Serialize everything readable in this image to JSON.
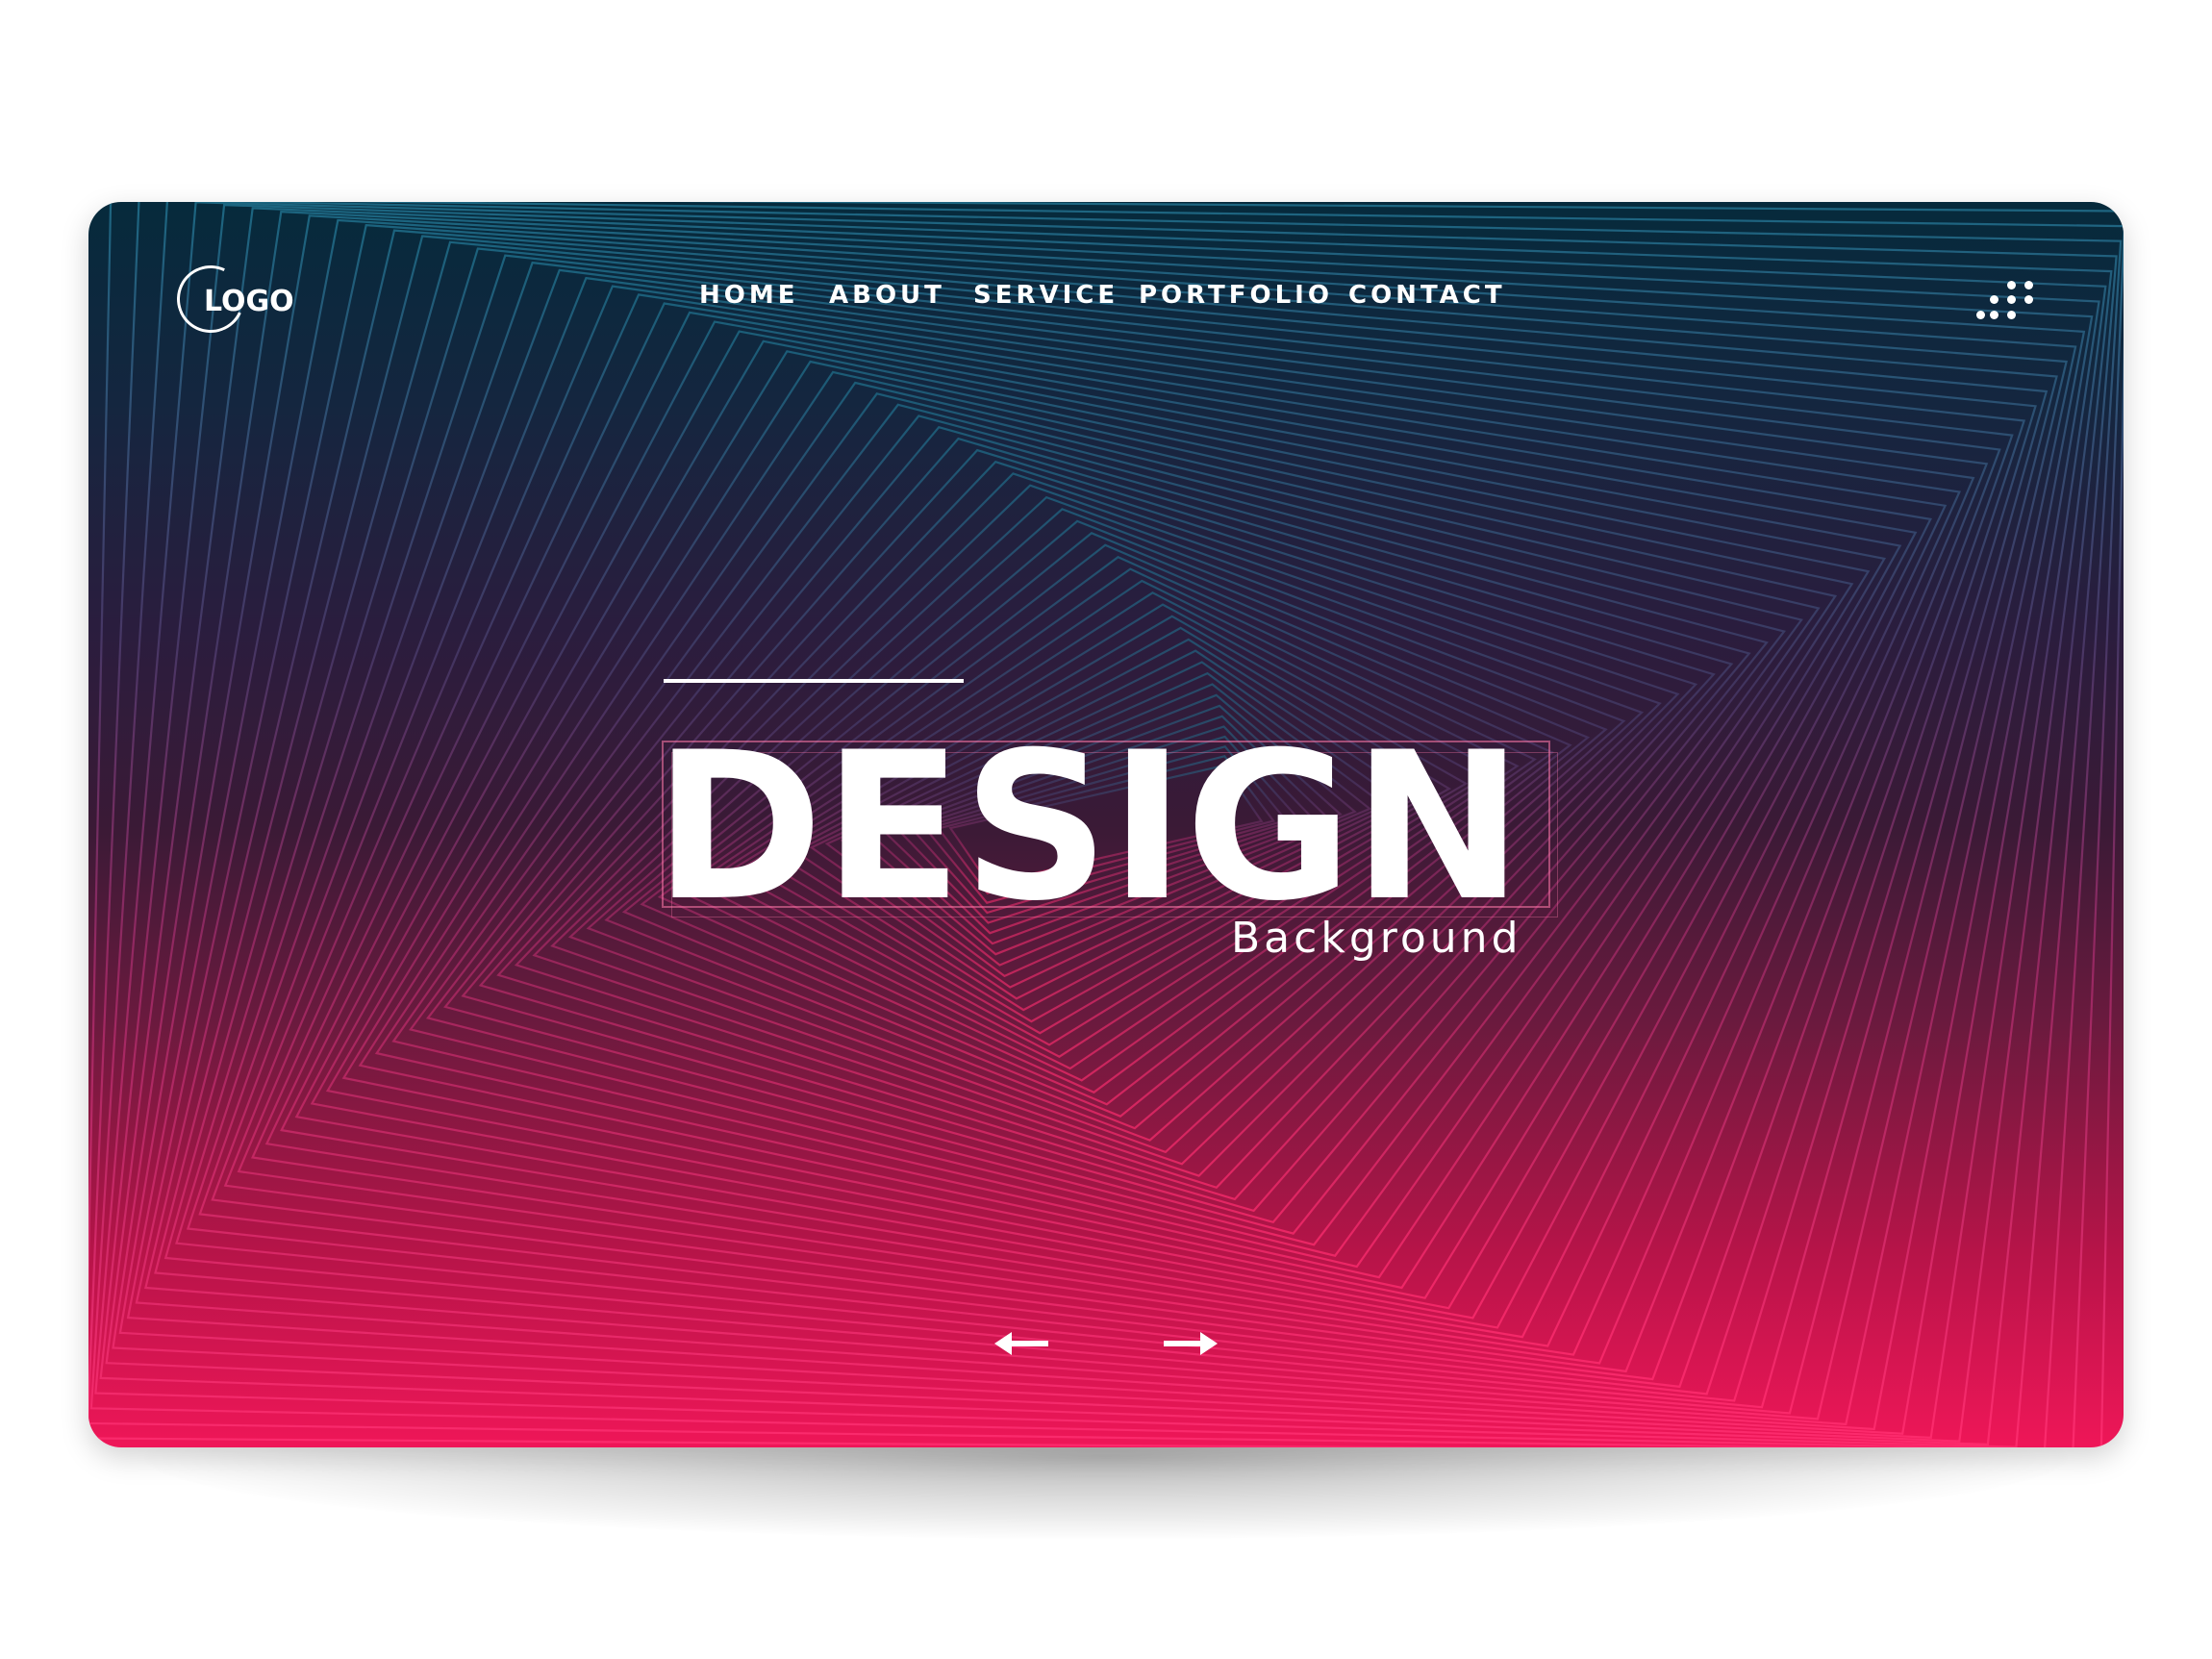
{
  "brand": {
    "logo_text": "LOGO"
  },
  "nav": {
    "items": [
      {
        "label": "HOME"
      },
      {
        "label": "ABOUT"
      },
      {
        "label": "SERVICE"
      },
      {
        "label": "PORTFOLIO"
      },
      {
        "label": "CONTACT"
      }
    ]
  },
  "hero": {
    "title": "DESIGN",
    "subtitle": "Background"
  },
  "icons": {
    "menu": "dots-grid-icon",
    "prev": "arrow-left-icon",
    "next": "arrow-right-icon",
    "logo": "circle-logo-icon"
  },
  "colors": {
    "top": "#062a3c",
    "middle": "#3a1a36",
    "bottom": "#ef1658",
    "line_top": "#1f6e8a",
    "line_bottom": "#ff2d6f",
    "text": "#ffffff"
  }
}
